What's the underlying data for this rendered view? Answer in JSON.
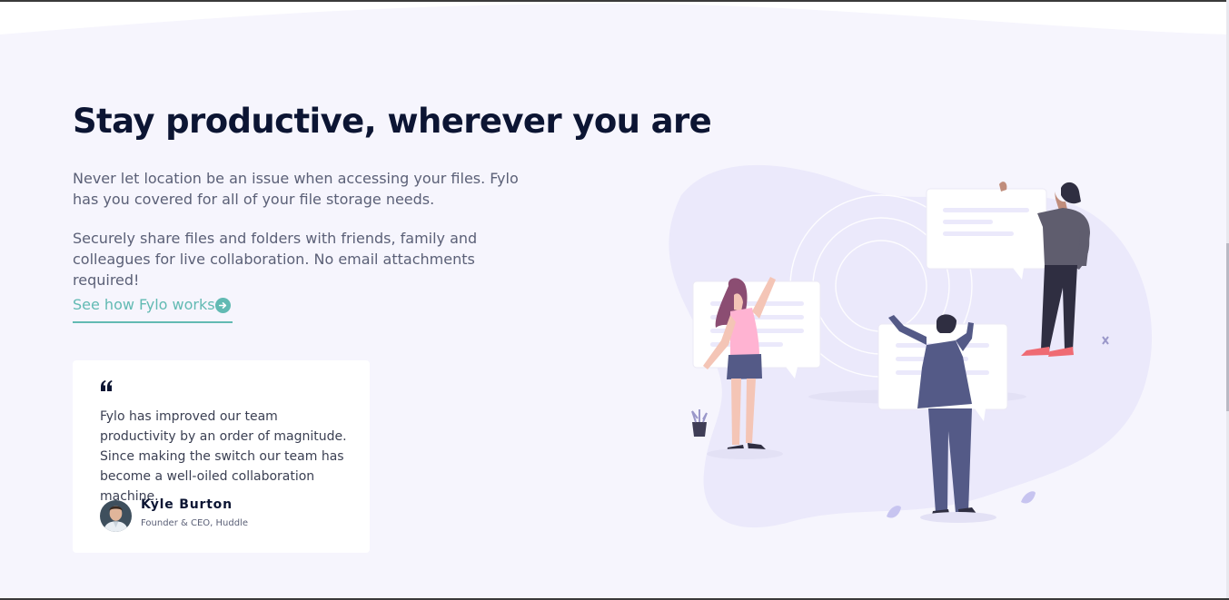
{
  "section": {
    "headline": "Stay productive, wherever you are",
    "paragraph_1": "Never let location be an issue when accessing your files. Fylo has you covered for all of your file storage needs.",
    "paragraph_2": "Securely share files and folders with friends, family and colleagues for live collaboration. No email attachments required!",
    "link_label": "See how Fylo works"
  },
  "testimonial": {
    "quote": "Fylo has improved our team productivity by an order of magnitude. Since making the switch our team has become a well-oiled collaboration machine.",
    "author_name": "Kyle Burton",
    "author_role": "Founder & CEO, Huddle"
  },
  "icons": {
    "link_arrow": "arrow-circle-right-icon",
    "quote": "quote-icon",
    "avatar": "avatar"
  },
  "colors": {
    "background": "#f6f5fd",
    "heading": "#0c1533",
    "body_text": "#5b6077",
    "accent": "#62bab3",
    "card": "#ffffff"
  }
}
